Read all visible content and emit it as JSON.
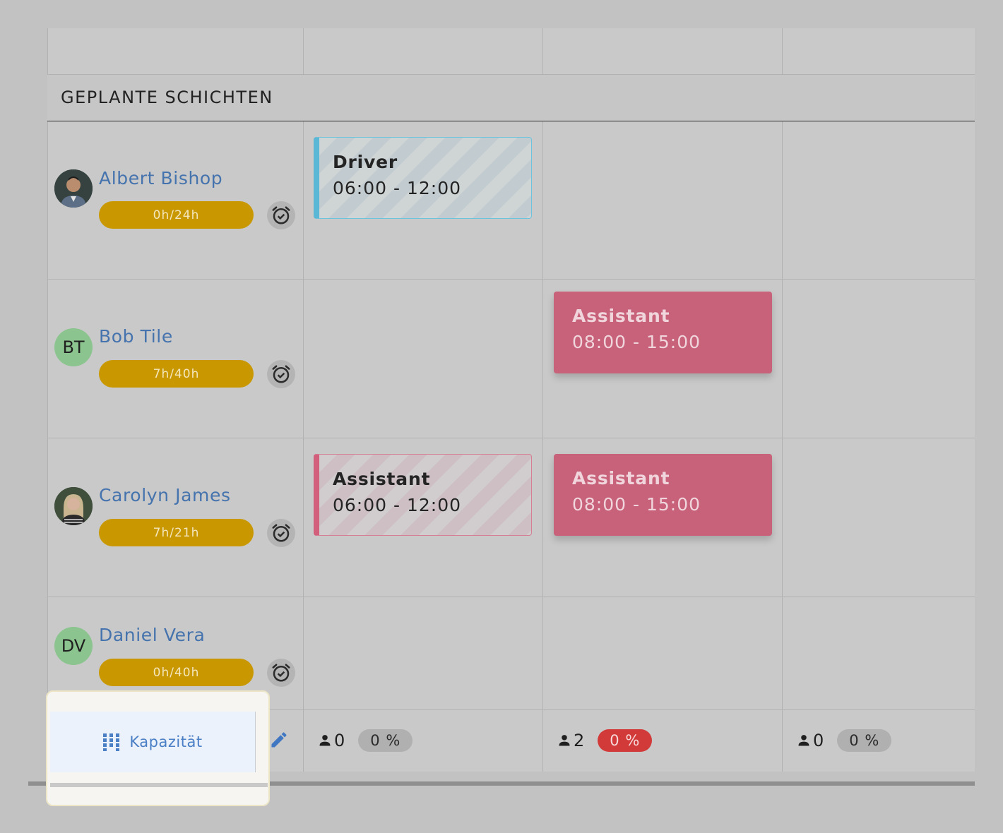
{
  "section": {
    "title": "GEPLANTE SCHICHTEN"
  },
  "employees": [
    {
      "name": "Albert Bishop",
      "hours": "0h/24h",
      "avatar": {
        "type": "photo",
        "icon": "person-photo-icon"
      }
    },
    {
      "name": "Bob Tile",
      "hours": "7h/40h",
      "avatar": {
        "type": "initials",
        "initials": "BT",
        "color": "#8bc48e"
      }
    },
    {
      "name": "Carolyn James",
      "hours": "7h/21h",
      "avatar": {
        "type": "photo",
        "icon": "person-photo-icon"
      }
    },
    {
      "name": "Daniel Vera",
      "hours": "0h/40h",
      "avatar": {
        "type": "initials",
        "initials": "DV",
        "color": "#8bc48e"
      }
    }
  ],
  "shifts": [
    {
      "employee": "Albert Bishop",
      "role": "Driver",
      "time": "06:00 - 12:00",
      "style": "striped-blue"
    },
    {
      "employee": "Bob Tile",
      "role": "Assistant",
      "time": "08:00 - 15:00",
      "style": "solid-red"
    },
    {
      "employee": "Carolyn James",
      "role": "Assistant",
      "time": "06:00 - 12:00",
      "style": "striped-red"
    },
    {
      "employee": "Carolyn James",
      "role": "Assistant",
      "time": "08:00 - 15:00",
      "style": "solid-red"
    }
  ],
  "footer": {
    "capacity_label": "Kapazität",
    "columns": [
      {
        "count": "0",
        "percent": "0 %",
        "status": "grey"
      },
      {
        "count": "2",
        "percent": "0 %",
        "status": "red"
      },
      {
        "count": "0",
        "percent": "0 %",
        "status": "grey"
      }
    ]
  },
  "icons": {
    "alarm": "alarm-check-icon",
    "person": "person-icon",
    "capacity": "grid-dots-icon",
    "edit": "pencil-icon"
  },
  "colors": {
    "hours_badge": "#c99800",
    "name_link": "#4573ad",
    "shift_red": "#c8617a",
    "shift_blue_accent": "#5ab8d6",
    "percent_alert": "#d23a3a"
  }
}
